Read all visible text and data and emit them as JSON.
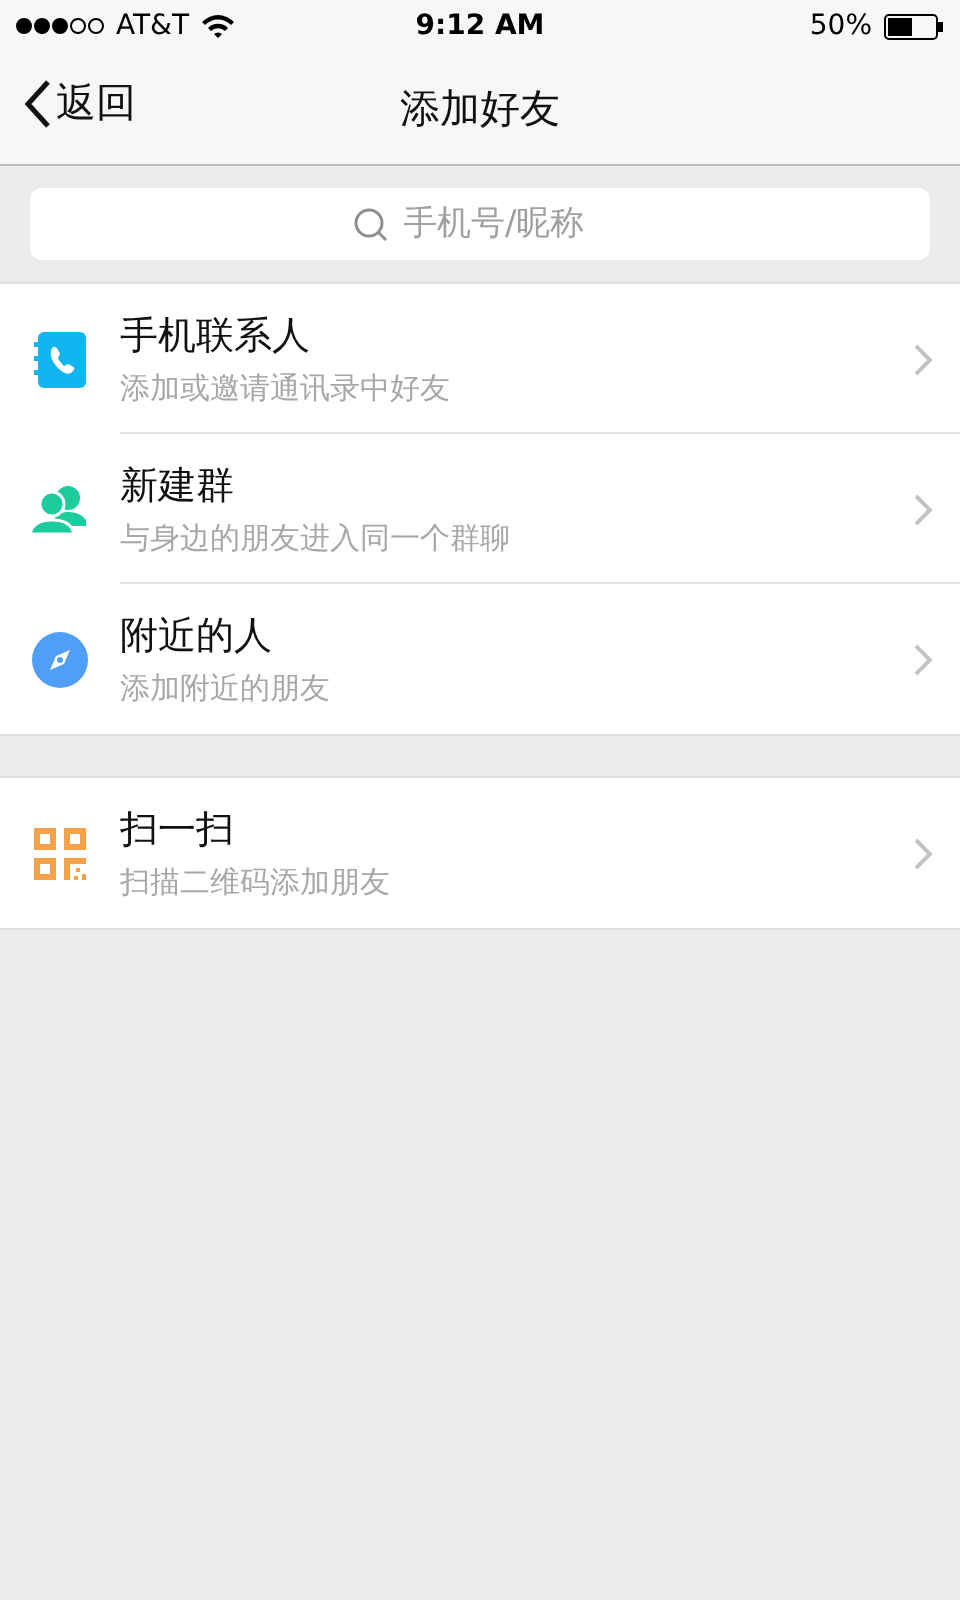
{
  "status_bar": {
    "carrier": "AT&T",
    "time": "9:12 AM",
    "battery": "50%"
  },
  "nav_bar": {
    "back": "返回",
    "title": "添加好友"
  },
  "search": {
    "placeholder": "手机号/昵称"
  },
  "groups": [
    {
      "items": [
        {
          "kind": "contacts",
          "title": "手机联系人",
          "subtitle": "添加或邀请通讯录中好友"
        },
        {
          "kind": "group",
          "title": "新建群",
          "subtitle": "与身边的朋友进入同一个群聊"
        },
        {
          "kind": "nearby",
          "title": "附近的人",
          "subtitle": "添加附近的朋友"
        }
      ]
    },
    {
      "items": [
        {
          "kind": "scan",
          "title": "扫一扫",
          "subtitle": "扫描二维码添加朋友"
        }
      ]
    }
  ]
}
